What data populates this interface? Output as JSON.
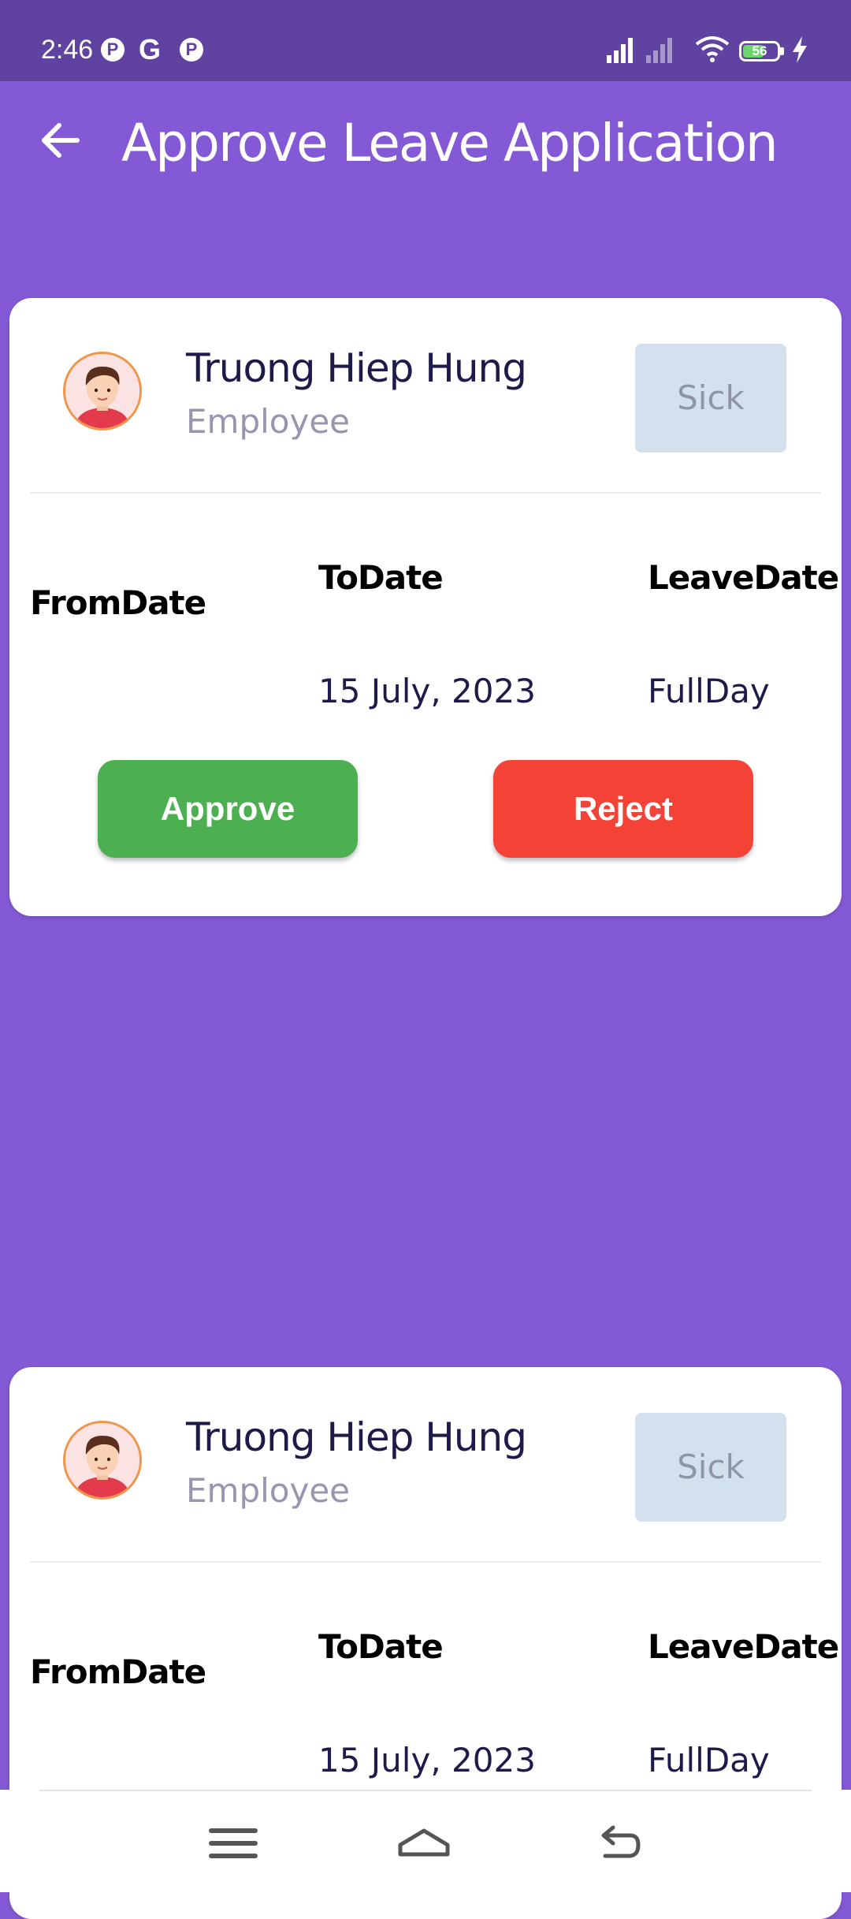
{
  "status_bar": {
    "time": "2:46",
    "app_icons": [
      "P",
      "G",
      "P"
    ],
    "battery_level": "56"
  },
  "app_bar": {
    "title": "Approve Leave Application",
    "back_icon": "arrow-left-icon"
  },
  "cards": [
    {
      "name": "Truong Hiep Hung",
      "role": "Employee",
      "leave_type": "Sick",
      "from_label": "FromDate",
      "to_label": "ToDate",
      "leave_label": "LeaveDate",
      "to_value": "15 July, 2023",
      "leave_value": "FullDay",
      "approve_label": "Approve",
      "reject_label": "Reject"
    },
    {
      "name": "Truong Hiep Hung",
      "role": "Employee",
      "leave_type": "Sick",
      "from_label": "FromDate",
      "to_label": "ToDate",
      "leave_label": "LeaveDate",
      "to_value": "15 July, 2023",
      "leave_value": "FullDay"
    }
  ],
  "bottom_nav": {
    "icons": [
      "menu-icon",
      "home-icon",
      "back-icon"
    ]
  },
  "colors": {
    "background": "#8459D5",
    "status_bar": "#6042A0",
    "approve": "#4CAF50",
    "reject": "#F44336",
    "leave_chip": "#D3E1EF"
  }
}
